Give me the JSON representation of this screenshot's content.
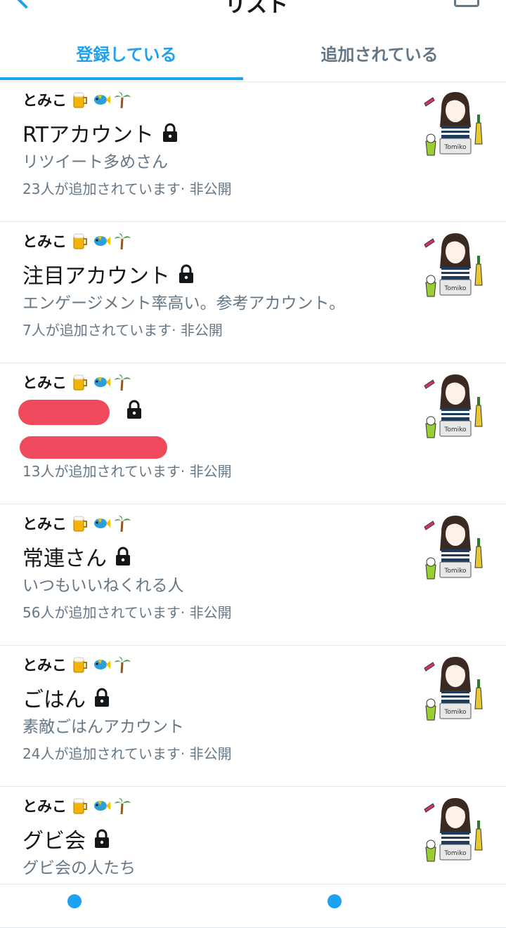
{
  "header": {
    "title_fragment": "リスト"
  },
  "tabs": [
    {
      "label": "登録している",
      "active": true
    },
    {
      "label": "追加されている",
      "active": false
    }
  ],
  "owner": {
    "name": "とみこ",
    "emojis": [
      "beer-emoji",
      "tropical-fish-emoji",
      "palm-tree-emoji"
    ]
  },
  "lists": [
    {
      "name": "RTアカウント",
      "description": "リツイート多めさん",
      "meta": "23人が追加されています· 非公開",
      "redacted": false
    },
    {
      "name": "注目アカウント",
      "description": "エンゲージメント率高い。参考アカウント。",
      "meta": "7人が追加されています· 非公開",
      "redacted": false
    },
    {
      "name": "",
      "description": "",
      "meta": "13人が追加されています· 非公開",
      "redacted": true
    },
    {
      "name": "常連さん",
      "description": "いつもいいねくれる人",
      "meta": "56人が追加されています· 非公開",
      "redacted": false
    },
    {
      "name": "ごはん",
      "description": "素敵ごはんアカウント",
      "meta": "24人が追加されています· 非公開",
      "redacted": false
    },
    {
      "name": "グビ会",
      "description": "グビ会の人たち",
      "meta": "",
      "redacted": false
    }
  ],
  "colors": {
    "accent": "#1da1f2",
    "secondary_text": "#657786",
    "redaction": "#ee4a5c"
  }
}
